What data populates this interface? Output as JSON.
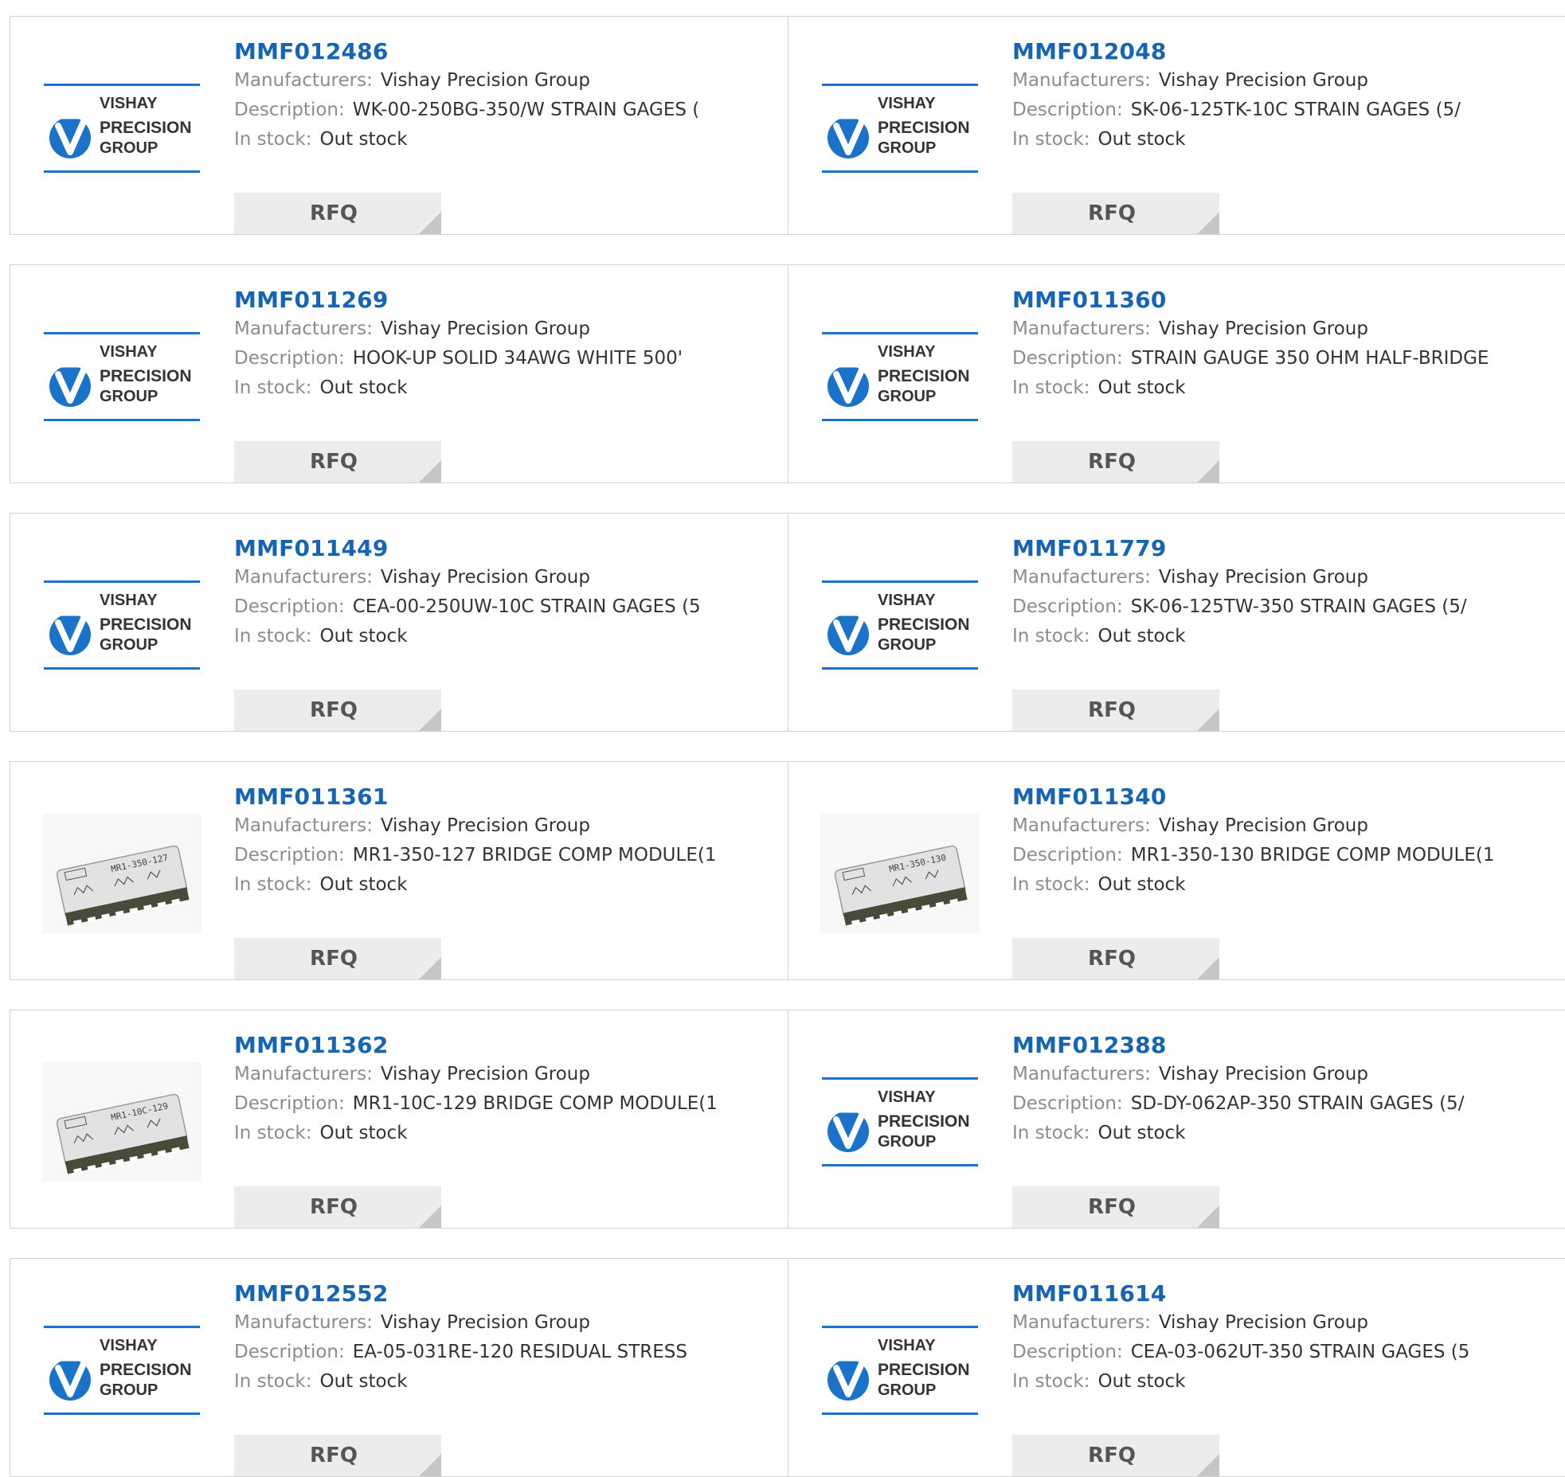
{
  "labels": {
    "manufacturer": "Manufacturers:",
    "description": "Description:",
    "stock": "In stock:",
    "rfq": "RFQ"
  },
  "logo": {
    "line1": "VISHAY",
    "line2": "PRECISION",
    "line3": "GROUP"
  },
  "colors": {
    "part_link": "#1664b4",
    "logo_blue": "#1a73c9"
  },
  "products": [
    {
      "pn": "MMF012486",
      "manufacturer": "Vishay Precision Group",
      "description": "WK-00-250BG-350/W STRAIN GAGES (",
      "stock": "Out stock",
      "image": "vishay-logo"
    },
    {
      "pn": "MMF012048",
      "manufacturer": "Vishay Precision Group",
      "description": "SK-06-125TK-10C STRAIN GAGES (5/",
      "stock": "Out stock",
      "image": "vishay-logo"
    },
    {
      "pn": "MMF011269",
      "manufacturer": "Vishay Precision Group",
      "description": "HOOK-UP SOLID 34AWG WHITE 500'",
      "stock": "Out stock",
      "image": "vishay-logo"
    },
    {
      "pn": "MMF011360",
      "manufacturer": "Vishay Precision Group",
      "description": "STRAIN GAUGE 350 OHM HALF-BRIDGE",
      "stock": "Out stock",
      "image": "vishay-logo"
    },
    {
      "pn": "MMF011449",
      "manufacturer": "Vishay Precision Group",
      "description": "CEA-00-250UW-10C STRAIN GAGES (5",
      "stock": "Out stock",
      "image": "vishay-logo"
    },
    {
      "pn": "MMF011779",
      "manufacturer": "Vishay Precision Group",
      "description": "SK-06-125TW-350 STRAIN GAGES (5/",
      "stock": "Out stock",
      "image": "vishay-logo"
    },
    {
      "pn": "MMF011361",
      "manufacturer": "Vishay Precision Group",
      "description": "MR1-350-127 BRIDGE COMP MODULE(1",
      "stock": "Out stock",
      "image": "module-photo",
      "module_label": "MR1-350-127"
    },
    {
      "pn": "MMF011340",
      "manufacturer": "Vishay Precision Group",
      "description": "MR1-350-130 BRIDGE COMP MODULE(1",
      "stock": "Out stock",
      "image": "module-photo",
      "module_label": "MR1-350-130"
    },
    {
      "pn": "MMF011362",
      "manufacturer": "Vishay Precision Group",
      "description": "MR1-10C-129 BRIDGE COMP MODULE(1",
      "stock": "Out stock",
      "image": "module-photo",
      "module_label": "MR1-10C-129"
    },
    {
      "pn": "MMF012388",
      "manufacturer": "Vishay Precision Group",
      "description": "SD-DY-062AP-350 STRAIN GAGES (5/",
      "stock": "Out stock",
      "image": "vishay-logo"
    },
    {
      "pn": "MMF012552",
      "manufacturer": "Vishay Precision Group",
      "description": "EA-05-031RE-120 RESIDUAL STRESS",
      "stock": "Out stock",
      "image": "vishay-logo"
    },
    {
      "pn": "MMF011614",
      "manufacturer": "Vishay Precision Group",
      "description": "CEA-03-062UT-350 STRAIN GAGES (5",
      "stock": "Out stock",
      "image": "vishay-logo"
    }
  ]
}
